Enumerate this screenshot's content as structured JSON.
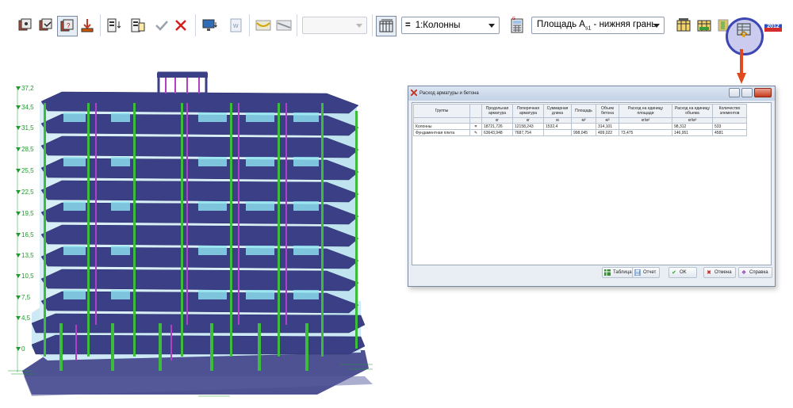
{
  "toolbar": {
    "load_combo": "1:Колонны",
    "load_combo_marker": "=",
    "result_combo_prefix": "Площадь A",
    "result_combo_sub": "s1",
    "result_combo_suffix": " - нижняя грань",
    "empty_combo": "",
    "year_badge": "2012"
  },
  "levels": [
    "37,2",
    "34,5",
    "31,5",
    "28,5",
    "25,5",
    "22,5",
    "19,5",
    "16,5",
    "13,5",
    "10,5",
    "7,5",
    "4,5",
    "0"
  ],
  "dialog": {
    "title": "Расход арматуры и бетона",
    "columns": [
      {
        "header": "Группы",
        "unit": ""
      },
      {
        "header": "",
        "unit": ""
      },
      {
        "header": "Продольная арматура",
        "unit": "кг"
      },
      {
        "header": "Поперечная арматура",
        "unit": "кг"
      },
      {
        "header": "Суммарная длина",
        "unit": "м"
      },
      {
        "header": "Площадь",
        "unit": "м²"
      },
      {
        "header": "Объем бетона",
        "unit": "м³"
      },
      {
        "header": "Расход на единицу площади",
        "unit": "кг/м²"
      },
      {
        "header": "Расход на единицу объема",
        "unit": "кг/м³"
      },
      {
        "header": "Количество элементов",
        "unit": ""
      }
    ],
    "rows": [
      [
        "Колонны",
        "=",
        "18721,726",
        "12158,243",
        "1532,4",
        "",
        "314,101",
        "",
        "98,312",
        "533"
      ],
      [
        "Фундаментная плита",
        "✎",
        "63643,948",
        "7687,754",
        "",
        "998,045",
        "499,022",
        "73,475",
        "146,951",
        "4581"
      ]
    ],
    "buttons": {
      "table": "Таблица",
      "report": "Отчет",
      "ok": "OK",
      "cancel": "Отмена",
      "help": "Справка"
    }
  },
  "colors": {
    "highlight_ring": "#3d47b2",
    "arrow": "#e04a1f",
    "column_green": "#3dbb3a",
    "slab_dark": "#3b3f86",
    "beam_purple": "#b43fc4",
    "wall_cyan": "#8fe6f2"
  }
}
